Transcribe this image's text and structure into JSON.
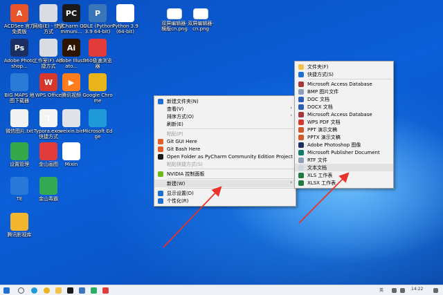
{
  "desktop": {
    "icons": [
      {
        "label": "ACDSee 官方免费版",
        "glyph": "A",
        "color": "#e8552b"
      },
      {
        "label": "网络(E) - 快捷方式",
        "glyph": "",
        "color": "#d9dde3"
      },
      {
        "label": "PyCharm Communi...",
        "glyph": "PC",
        "color": "#1a1a1a"
      },
      {
        "label": "IDLE (Python 3.9 64-bit)",
        "glyph": "P",
        "color": "#3b77b8"
      },
      {
        "label": "Python 3.9 (64-bit)",
        "glyph": "",
        "color": "#ffffff"
      },
      {
        "label": "Adobe Photoshop...",
        "glyph": "Ps",
        "color": "#1c2f63"
      },
      {
        "label": "工作室(F) - 快捷方式",
        "glyph": "",
        "color": "#d9dde3"
      },
      {
        "label": "Adobe Illustrato...",
        "glyph": "Ai",
        "color": "#2d1400"
      },
      {
        "label": "360极速浏览器",
        "glyph": "",
        "color": "#e23b3b"
      },
      {
        "label": "BIG MAPS 地图下载器",
        "glyph": "",
        "color": "#2a7ad6"
      },
      {
        "label": "WPS Office",
        "glyph": "W",
        "color": "#d7382e"
      },
      {
        "label": "腾讯视频",
        "glyph": "▶",
        "color": "#ff7d1c"
      },
      {
        "label": "Google Chrome",
        "glyph": "",
        "color": "#e9b41b"
      },
      {
        "label": "微信图片.txt",
        "glyph": "",
        "color": "#f2f2f2"
      },
      {
        "label": "Typora.exe - 快捷方式",
        "glyph": "T",
        "color": "#f4f4f4"
      },
      {
        "label": "weixin.bin",
        "glyph": "",
        "color": "#dfe3e8"
      },
      {
        "label": "Microsoft Edge",
        "glyph": "",
        "color": "#1f9bd9"
      },
      {
        "label": "设置管理",
        "glyph": "",
        "color": "#37a84a"
      },
      {
        "label": "金山画图",
        "glyph": "",
        "color": "#e23b3b"
      },
      {
        "label": "Mixin",
        "glyph": "",
        "color": "#ffffff"
      },
      {
        "label": "TE",
        "glyph": "",
        "color": "#2878d8"
      },
      {
        "label": "金山毒霸",
        "glyph": "",
        "color": "#34a853"
      },
      {
        "label": "腾讯影视库",
        "glyph": "",
        "color": "#f2b630"
      }
    ],
    "files": [
      {
        "label": "双屏编辑器-横版cn.png"
      },
      {
        "label": "双屏编辑器-cn.png"
      }
    ]
  },
  "context_menu": {
    "items": [
      {
        "label": "新建文件夹(N)",
        "type": "item",
        "icon": "folder-badge-icon",
        "color": "#1d6fd6"
      },
      {
        "label": "查看(V)",
        "type": "submenu"
      },
      {
        "label": "排序方式(O)",
        "type": "submenu"
      },
      {
        "label": "刷新(E)",
        "type": "item"
      },
      {
        "type": "sep"
      },
      {
        "label": "粘贴(P)",
        "type": "disabled"
      },
      {
        "label": "Git GUI Here",
        "type": "item",
        "icon": "git-icon",
        "color": "#e45b2c"
      },
      {
        "label": "Git Bash Here",
        "type": "item",
        "icon": "git-icon",
        "color": "#e45b2c"
      },
      {
        "label": "Open Folder as PyCharm Community Edition Project",
        "type": "item",
        "icon": "pycharm-icon",
        "color": "#1a1a1a"
      },
      {
        "label": "粘贴快捷方式(S)",
        "type": "disabled"
      },
      {
        "type": "sep"
      },
      {
        "label": "NVIDIA 控制面板",
        "type": "item",
        "icon": "nvidia-icon",
        "color": "#6fb81c"
      },
      {
        "type": "sep"
      },
      {
        "label": "新建(W)",
        "type": "submenu",
        "highlight": true
      },
      {
        "type": "sep"
      },
      {
        "label": "显示设置(D)",
        "type": "item",
        "icon": "display-icon",
        "color": "#1e6fd0"
      },
      {
        "label": "个性化(R)",
        "type": "item",
        "icon": "personalize-icon",
        "color": "#1e6fd0"
      }
    ]
  },
  "new_submenu": {
    "items": [
      {
        "label": "文件夹(F)",
        "type": "item",
        "icon": "folder-icon",
        "color": "#f2c24d"
      },
      {
        "label": "快捷方式(S)",
        "type": "item",
        "icon": "shortcut-icon",
        "color": "#1e6fd0"
      },
      {
        "type": "sep"
      },
      {
        "label": "Microsoft Access Database",
        "type": "item",
        "icon": "access-icon",
        "color": "#a4373a"
      },
      {
        "label": "BMP 图片文件",
        "type": "item",
        "icon": "bmp-icon",
        "color": "#8aa0b8"
      },
      {
        "label": "DOC 文档",
        "type": "item",
        "icon": "doc-icon",
        "color": "#2b5eb6"
      },
      {
        "label": "DOCX 文档",
        "type": "item",
        "icon": "docx-icon",
        "color": "#2b5eb6"
      },
      {
        "label": "Microsoft Access Database",
        "type": "item",
        "icon": "access-icon",
        "color": "#a4373a"
      },
      {
        "label": "WPS PDF 文档",
        "type": "item",
        "icon": "pdf-icon",
        "color": "#d9362b"
      },
      {
        "label": "PPT 演示文稿",
        "type": "item",
        "icon": "ppt-icon",
        "color": "#d2582a"
      },
      {
        "label": "PPTX 演示文稿",
        "type": "item",
        "icon": "pptx-icon",
        "color": "#d2582a"
      },
      {
        "label": "Adobe Photoshop 图像",
        "type": "item",
        "icon": "photoshop-icon",
        "color": "#1c2f63"
      },
      {
        "label": "Microsoft Publisher Document",
        "type": "item",
        "icon": "publisher-icon",
        "color": "#0f7a6a"
      },
      {
        "label": "RTF 文件",
        "type": "item",
        "icon": "rtf-icon",
        "color": "#8aa0b8"
      },
      {
        "label": "文本文档",
        "type": "item",
        "icon": "text-doc-icon",
        "color": "#cfd6de",
        "highlight": true
      },
      {
        "label": "XLS 工作表",
        "type": "item",
        "icon": "xls-icon",
        "color": "#1e7a3f"
      },
      {
        "label": "XLSX 工作表",
        "type": "item",
        "icon": "xlsx-icon",
        "color": "#1e7a3f"
      }
    ]
  },
  "annotation_color": "#e8322a",
  "taskbar": {
    "clock": "14:22",
    "tray_text": "英"
  }
}
